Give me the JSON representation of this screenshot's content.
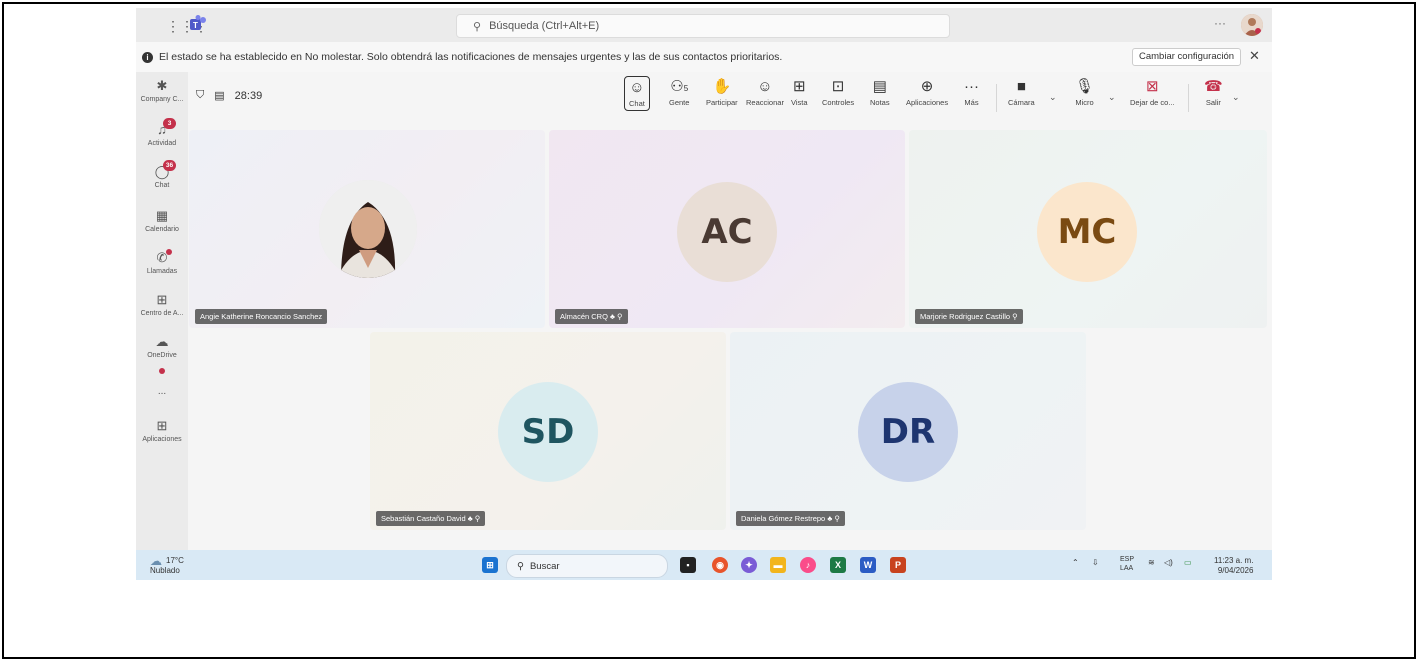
{
  "titlebar": {
    "search_placeholder": "Búsqueda (Ctrl+Alt+E)",
    "more": "···"
  },
  "notification": {
    "text": "El estado se ha establecido en No molestar. Solo obtendrá las notificaciones de mensajes urgentes y las de sus contactos prioritarios.",
    "button": "Cambiar configuración",
    "close": "✕"
  },
  "rail": {
    "items": [
      {
        "label": "Company C...",
        "icon": "company-icon"
      },
      {
        "label": "Actividad",
        "icon": "bell-icon",
        "badge": "3"
      },
      {
        "label": "Chat",
        "icon": "chat-icon",
        "badge": "36"
      },
      {
        "label": "Calendario",
        "icon": "calendar-icon"
      },
      {
        "label": "Llamadas",
        "icon": "phone-icon"
      },
      {
        "label": "Centro de A...",
        "icon": "apps-center-icon"
      },
      {
        "label": "OneDrive",
        "icon": "onedrive-icon"
      },
      {
        "label": "...",
        "icon": "more-icon"
      },
      {
        "label": "Aplicaciones",
        "icon": "add-apps-icon"
      }
    ]
  },
  "meeting": {
    "timer": "28:39",
    "people_count": "5",
    "toolbar": {
      "chat": "Chat",
      "people": "Gente",
      "raise": "Participar",
      "react": "Reaccionar",
      "view": "Vista",
      "controls": "Controles",
      "notes": "Notas",
      "apps": "Aplicaciones",
      "more": "Más",
      "camera": "Cámara",
      "mic": "Micro",
      "share": "Dejar de co...",
      "leave": "Salir"
    }
  },
  "participants": [
    {
      "name": "Angie Katherine Roncancio Sanchez",
      "initials": "",
      "has_photo": true
    },
    {
      "name": "Almacén CRQ",
      "initials": "AC",
      "color": "#e9ded6",
      "text_color": "#4a3a33"
    },
    {
      "name": "Marjorie Rodriguez Castillo",
      "initials": "MC",
      "color": "#fbe6cc",
      "text_color": "#7a4a12"
    },
    {
      "name": "Sebastián Castaño David",
      "initials": "SD",
      "color": "#d9ecef",
      "text_color": "#1f5560"
    },
    {
      "name": "Daniela Gómez Restrepo",
      "initials": "DR",
      "color": "#c7d2ea",
      "text_color": "#1e3570"
    }
  ],
  "taskbar": {
    "temp": "17°C",
    "weather": "Nublado",
    "search": "Buscar",
    "lang1": "ESP",
    "lang2": "LAA",
    "time": "11:23 a. m.",
    "date": "9/04/2026"
  }
}
